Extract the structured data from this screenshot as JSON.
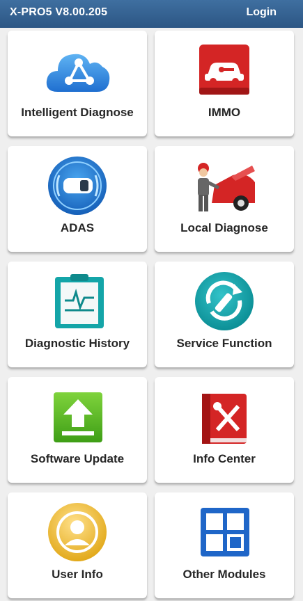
{
  "header": {
    "title": "X-PRO5 V8.00.205",
    "login_label": "Login"
  },
  "tiles": [
    {
      "label": "Intelligent Diagnose",
      "icon": "cloud-network-icon"
    },
    {
      "label": "IMMO",
      "icon": "car-key-icon"
    },
    {
      "label": "ADAS",
      "icon": "car-radar-icon"
    },
    {
      "label": "Local Diagnose",
      "icon": "mechanic-icon"
    },
    {
      "label": "Diagnostic History",
      "icon": "clipboard-waveform-icon"
    },
    {
      "label": "Service Function",
      "icon": "wrench-refresh-icon"
    },
    {
      "label": "Software Update",
      "icon": "upload-icon"
    },
    {
      "label": "Info Center",
      "icon": "tool-book-icon"
    },
    {
      "label": "User Info",
      "icon": "user-icon"
    },
    {
      "label": "Other Modules",
      "icon": "modules-grid-icon"
    }
  ]
}
